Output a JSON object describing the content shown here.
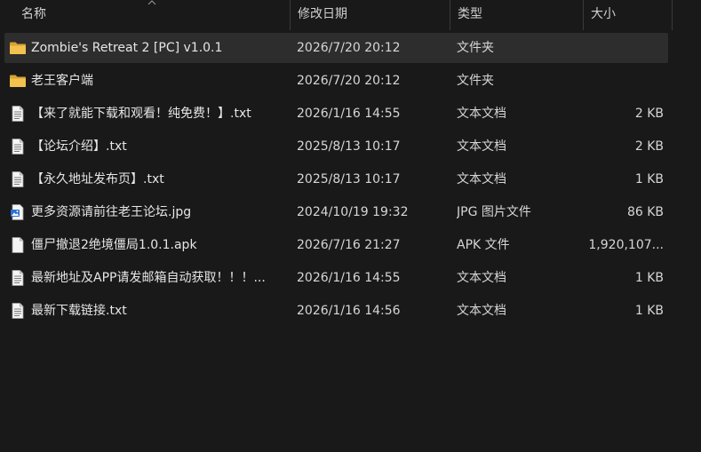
{
  "columns": {
    "name": "名称",
    "date": "修改日期",
    "type": "类型",
    "size": "大小"
  },
  "rows": [
    {
      "icon": "folder-icon",
      "name": "Zombie's Retreat 2 [PC] v1.0.1",
      "date": "2026/7/20 20:12",
      "type": "文件夹",
      "size": "",
      "selected": true
    },
    {
      "icon": "folder-icon",
      "name": "老王客户端",
      "date": "2026/7/20 20:12",
      "type": "文件夹",
      "size": ""
    },
    {
      "icon": "text-document-icon",
      "name": "【来了就能下载和观看！纯免费！】.txt",
      "date": "2026/1/16 14:55",
      "type": "文本文档",
      "size": "2 KB"
    },
    {
      "icon": "text-document-icon",
      "name": "【论坛介绍】.txt",
      "date": "2025/8/13 10:17",
      "type": "文本文档",
      "size": "2 KB"
    },
    {
      "icon": "text-document-icon",
      "name": "【永久地址发布页】.txt",
      "date": "2025/8/13 10:17",
      "type": "文本文档",
      "size": "1 KB"
    },
    {
      "icon": "image-file-icon",
      "name": "更多资源请前往老王论坛.jpg",
      "date": "2024/10/19 19:32",
      "type": "JPG 图片文件",
      "size": "86 KB"
    },
    {
      "icon": "blank-file-icon",
      "name": "僵尸撤退2绝境僵局1.0.1.apk",
      "date": "2026/7/16 21:27",
      "type": "APK 文件",
      "size": "1,920,107..."
    },
    {
      "icon": "text-document-icon",
      "name": "最新地址及APP请发邮箱自动获取！！！...",
      "date": "2026/1/16 14:55",
      "type": "文本文档",
      "size": "1 KB"
    },
    {
      "icon": "text-document-icon",
      "name": "最新下载链接.txt",
      "date": "2026/1/16 14:56",
      "type": "文本文档",
      "size": "1 KB"
    }
  ],
  "colors": {
    "background": "#191919",
    "selected_row": "#2d2d2d",
    "folder": "#f2c14e",
    "text": "#e6e6e6"
  }
}
